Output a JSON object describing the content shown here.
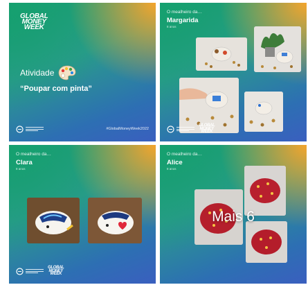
{
  "tile1": {
    "logo_lines": [
      "GLOBAL",
      "MONEY",
      "WEEK"
    ],
    "activity_label": "Atividade",
    "activity_title": "“Poupar com pinta”",
    "hashtag": "#GlobalMoneyWeek2022"
  },
  "tile2": {
    "subtitle": "O mealheiro da…",
    "name": "Margarida",
    "age": "8 anos"
  },
  "tile3": {
    "subtitle": "O mealheiro da…",
    "name": "Clara",
    "age": "8 anos"
  },
  "tile4": {
    "subtitle": "O mealheiro da…",
    "name": "Alice",
    "age": "8 anos",
    "more_label": "Mais 6"
  },
  "footer_logo_lines": [
    "GLOBAL",
    "MONEY",
    "WEEK"
  ],
  "colors": {
    "gradient_green": "#1c9e73",
    "gradient_blue": "#2d6fb3",
    "gradient_orange": "#ffa528"
  },
  "icons": [
    "palette-icon",
    "org-logo-icon"
  ]
}
